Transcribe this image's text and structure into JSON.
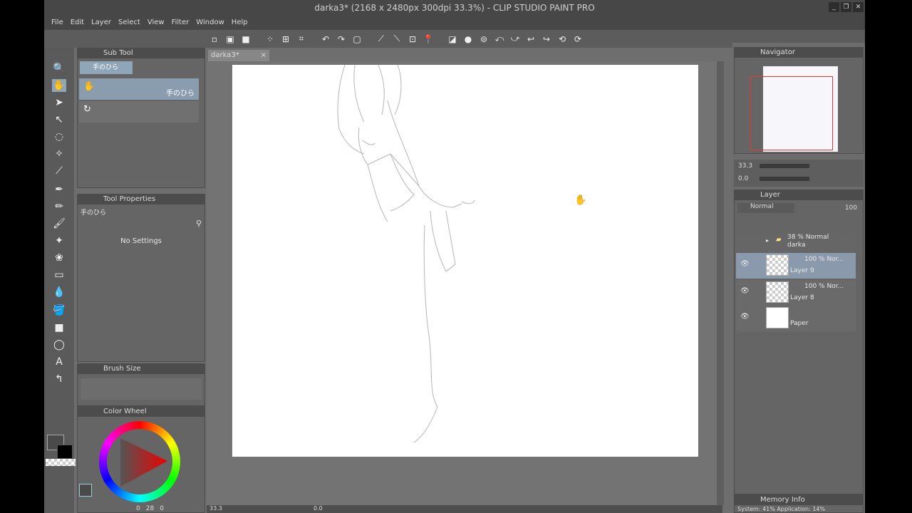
{
  "window": {
    "title": "darka3* (2168 x 2480px 300dpi 33.3%) - CLIP STUDIO PAINT PRO",
    "controls": [
      "_",
      "❐",
      "✕"
    ]
  },
  "menu": [
    "File",
    "Edit",
    "Layer",
    "Select",
    "View",
    "Filter",
    "Window",
    "Help"
  ],
  "canvas_tab": {
    "label": "darka3*",
    "close": "×"
  },
  "subtool": {
    "title": "Sub Tool",
    "tab_label": "手のひら",
    "items": [
      {
        "label": "手のひら"
      },
      {
        "label": ""
      }
    ]
  },
  "tool_properties": {
    "title": "Tool Properties",
    "tool_name": "手のひら",
    "message": "No Settings"
  },
  "brush_size": {
    "title": "Brush Size"
  },
  "color_wheel": {
    "title": "Color Wheel",
    "values": [
      "0",
      "28",
      "0"
    ]
  },
  "navigator": {
    "title": "Navigator",
    "zoom": "33.3",
    "angle": "0.0"
  },
  "layer_panel": {
    "title": "Layer",
    "blend_mode": "Normal",
    "opacity": "100",
    "layers": [
      {
        "name": "darka",
        "meta": "38 %  Normal",
        "type": "folder"
      },
      {
        "name": "Layer 9",
        "meta": "100 %  Nor...",
        "type": "raster",
        "selected": true
      },
      {
        "name": "Layer 8",
        "meta": "100 %  Nor...",
        "type": "raster"
      },
      {
        "name": "Paper",
        "meta": "",
        "type": "paper"
      }
    ]
  },
  "memory": {
    "title": "Memory Info",
    "text": "System: 41%  Application: 14%"
  },
  "status": {
    "zoom": "33.3",
    "angle": "0.0"
  },
  "colors": {
    "main": "#4a4a4a",
    "sub": "#000000",
    "accent": "#8fa6b8",
    "nav_frame": "#e33333"
  }
}
